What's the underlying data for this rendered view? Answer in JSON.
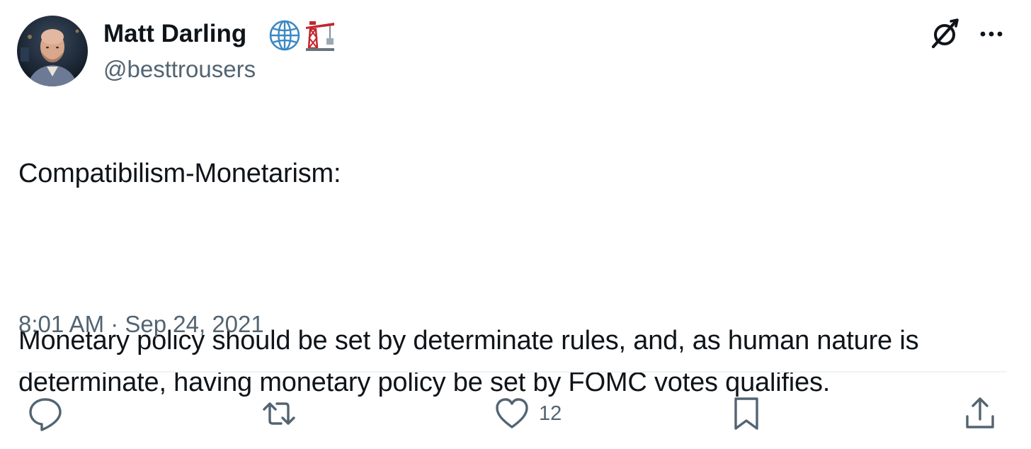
{
  "author": {
    "name": "Matt Darling",
    "handle": "@besttrousers",
    "badges": [
      "globe-icon",
      "crane-icon"
    ]
  },
  "header_icons": [
    "grok-icon",
    "more-options-icon"
  ],
  "tweet": {
    "paragraphs": [
      "Compatibilism-Monetarism:",
      "Monetary policy should be set by determinate rules, and, as human nature is determinate, having monetary policy be set by FOMC votes qualifies."
    ],
    "timestamp": "8:01 AM · Sep 24, 2021"
  },
  "actions": {
    "reply": {
      "icon": "reply-icon",
      "count": ""
    },
    "retweet": {
      "icon": "retweet-icon",
      "count": ""
    },
    "like": {
      "icon": "heart-icon",
      "count": "12"
    },
    "bookmark": {
      "icon": "bookmark-icon",
      "count": ""
    },
    "share": {
      "icon": "share-icon",
      "count": ""
    }
  },
  "colors": {
    "text": "#0f1419",
    "secondary": "#536471",
    "divider": "#eff3f4",
    "globe": "#3b88c3",
    "crane": "#c1272d"
  }
}
